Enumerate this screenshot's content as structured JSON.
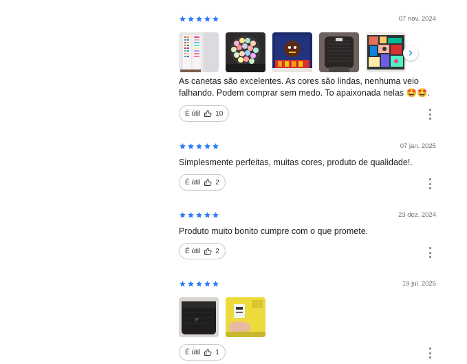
{
  "accent_color": "#2e7cf6",
  "reviews": [
    {
      "stars": 5,
      "date": "07 nov. 2024",
      "text": "As canetas são excelentes. As cores são lindas, nenhuma veio falhando. Podem comprar sem medo. To apaixonada nelas 🤩🤩.",
      "useful_label": "É útil",
      "useful_count": "10",
      "photos": [
        "photo-marker-swatches",
        "photo-marker-caps",
        "photo-drawing-red",
        "photo-black-case",
        "photo-colorful-art"
      ]
    },
    {
      "stars": 5,
      "date": "07 jan. 2025",
      "text": "Simplesmente perfeitas, muitas cores, produto de qualidade!.",
      "useful_label": "É útil",
      "useful_count": "2"
    },
    {
      "stars": 5,
      "date": "23 dez. 2024",
      "text": "Produto muito bonito cumpre com o que promete.",
      "useful_label": "É útil",
      "useful_count": "2"
    },
    {
      "stars": 5,
      "date": "19 jul. 2025",
      "text": "",
      "useful_label": "É útil",
      "useful_count": "1",
      "photos": [
        "photo-black-pouch",
        "photo-yellow-package"
      ]
    }
  ]
}
